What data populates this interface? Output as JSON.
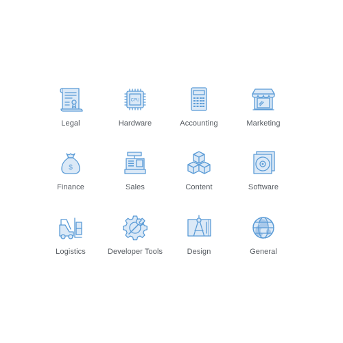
{
  "colors": {
    "icon_stroke": "#5a9bd6",
    "icon_fill": "#dbe9f7",
    "label": "#555a60",
    "background": "#ffffff"
  },
  "categories": [
    {
      "label": "Legal",
      "icon": "certificate-scroll-icon"
    },
    {
      "label": "Hardware",
      "icon": "cpu-chip-icon",
      "icon_text": "CPU"
    },
    {
      "label": "Accounting",
      "icon": "calculator-icon"
    },
    {
      "label": "Marketing",
      "icon": "storefront-icon"
    },
    {
      "label": "Finance",
      "icon": "money-bag-icon",
      "icon_text": "$"
    },
    {
      "label": "Sales",
      "icon": "cash-register-icon"
    },
    {
      "label": "Content",
      "icon": "stacked-boxes-icon"
    },
    {
      "label": "Software",
      "icon": "cd-case-icon"
    },
    {
      "label": "Logistics",
      "icon": "forklift-icon"
    },
    {
      "label": "Developer Tools",
      "icon": "gear-wrench-icon"
    },
    {
      "label": "Design",
      "icon": "blueprint-compass-icon"
    },
    {
      "label": "General",
      "icon": "globe-icon"
    }
  ]
}
